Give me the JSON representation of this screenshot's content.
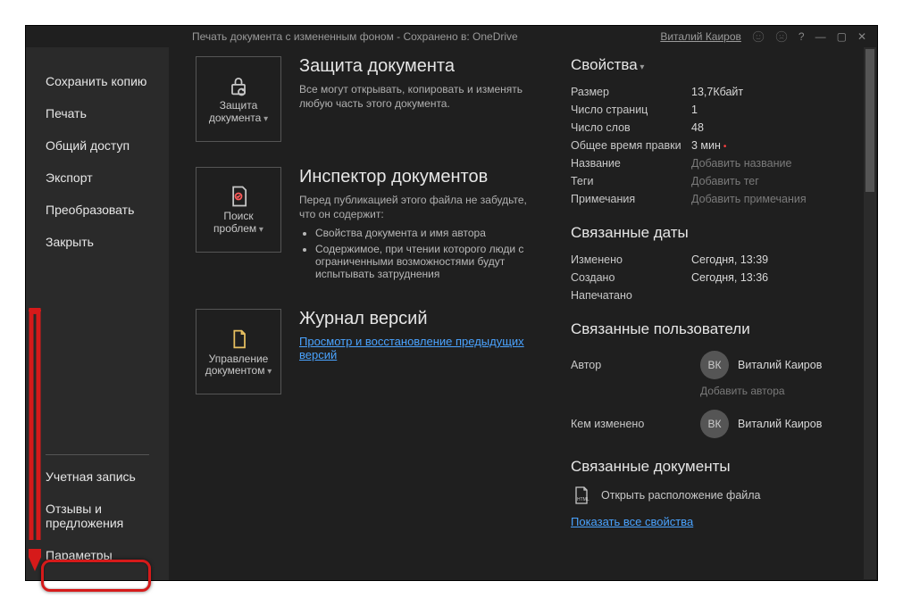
{
  "titlebar": {
    "doc_title": "Печать документа с измененным фоном  -  Сохранено в: OneDrive",
    "user": "Виталий Каиров"
  },
  "sidebar": {
    "items": [
      {
        "label": "Сохранить копию"
      },
      {
        "label": "Печать"
      },
      {
        "label": "Общий доступ"
      },
      {
        "label": "Экспорт"
      },
      {
        "label": "Преобразовать"
      },
      {
        "label": "Закрыть"
      }
    ],
    "bottom": [
      {
        "label": "Учетная запись"
      },
      {
        "label": "Отзывы и предложения"
      },
      {
        "label": "Параметры"
      }
    ]
  },
  "midcol": {
    "protect": {
      "tile_label": "Защита документа",
      "heading": "Защита документа",
      "desc": "Все могут открывать, копировать и изменять любую часть этого документа."
    },
    "inspect": {
      "tile_label": "Поиск проблем",
      "heading": "Инспектор документов",
      "desc": "Перед публикацией этого файла не забудьте, что он содержит:",
      "bullets": [
        "Свойства документа и имя автора",
        "Содержимое, при чтении которого люди с ограниченными возможностями будут испытывать затруднения"
      ]
    },
    "versions": {
      "tile_label": "Управление документом",
      "heading": "Журнал версий",
      "link": "Просмотр и восстановление предыдущих версий"
    }
  },
  "right": {
    "properties_heading": "Свойства",
    "props": {
      "size_k": "Размер",
      "size_v": "13,7Кбайт",
      "pages_k": "Число страниц",
      "pages_v": "1",
      "words_k": "Число слов",
      "words_v": "48",
      "edit_k": "Общее время правки",
      "edit_v": "3 мин",
      "title_k": "Название",
      "title_hint": "Добавить название",
      "tags_k": "Теги",
      "tags_hint": "Добавить тег",
      "notes_k": "Примечания",
      "notes_hint": "Добавить примечания"
    },
    "dates_heading": "Связанные даты",
    "dates": {
      "modified_k": "Изменено",
      "modified_v": "Сегодня, 13:39",
      "created_k": "Создано",
      "created_v": "Сегодня, 13:36",
      "printed_k": "Напечатано"
    },
    "users_heading": "Связанные пользователи",
    "users": {
      "author_k": "Автор",
      "author_initials": "ВК",
      "author_name": "Виталий Каиров",
      "add_author_hint": "Добавить автора",
      "modifiedby_k": "Кем изменено",
      "modifiedby_initials": "ВК",
      "modifiedby_name": "Виталий Каиров"
    },
    "docs_heading": "Связанные документы",
    "open_location": "Открыть расположение файла",
    "show_all": "Показать все свойства"
  }
}
